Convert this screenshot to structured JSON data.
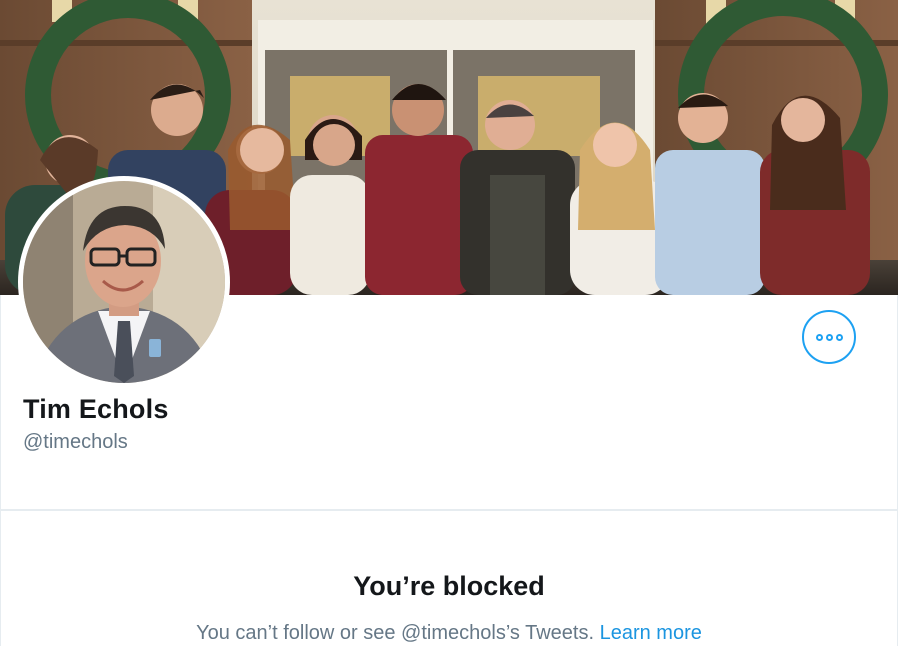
{
  "profile": {
    "display_name": "Tim Echols",
    "handle": "@timechols"
  },
  "blocked": {
    "title": "You’re blocked",
    "message": "You can’t follow or see @timechols’s Tweets.",
    "learn_more": "Learn more"
  },
  "icons": {
    "more": "more-options-icon"
  },
  "colors": {
    "accent": "#1da1f2",
    "link": "#1b95e0",
    "name": "#14171a",
    "muted": "#657786",
    "border": "#e6ecf0"
  }
}
